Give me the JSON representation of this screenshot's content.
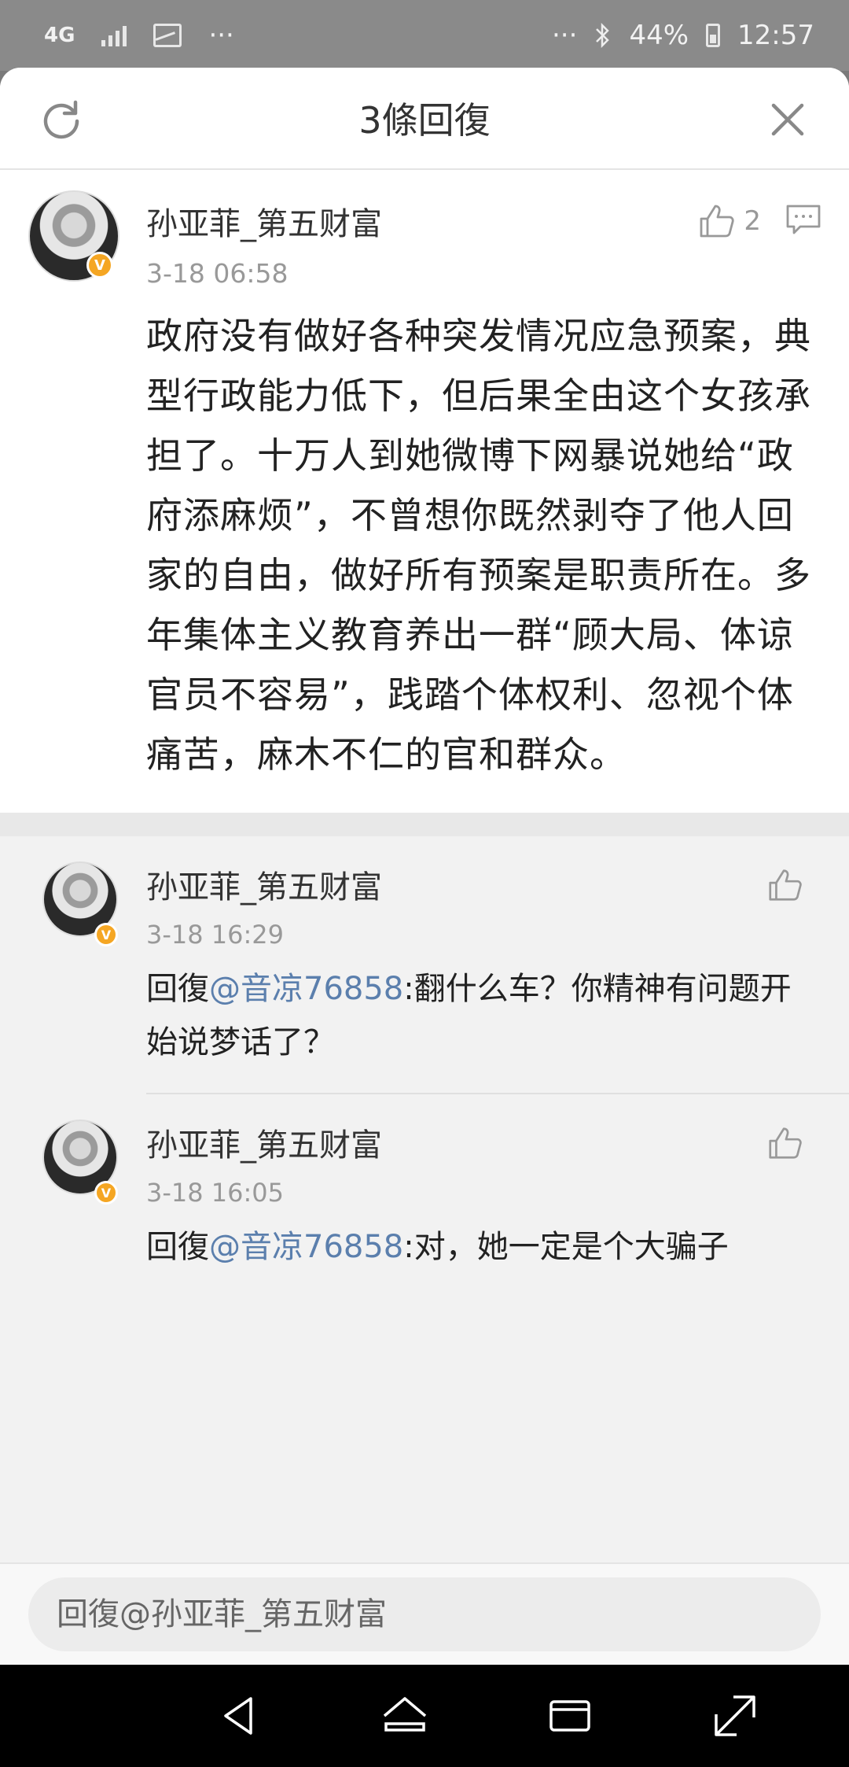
{
  "status_bar": {
    "network": "4G",
    "more": "···",
    "more_right": "···",
    "battery_percent": "44%",
    "time": "12:57"
  },
  "header": {
    "title": "3條回復"
  },
  "main_comment": {
    "username": "孙亚菲_第五财富",
    "time": "3-18 06:58",
    "like_count": "2",
    "text": "政府没有做好各种突发情况应急预案，典型行政能力低下，但后果全由这个女孩承担了。十万人到她微博下网暴说她给“政府添麻烦”，不曾想你既然剥夺了他人回家的自由，做好所有预案是职责所在。多年集体主义教育养出一群“顾大局、体谅官员不容易”，践踏个体权利、忽视个体痛苦，麻木不仁的官和群众。"
  },
  "replies": [
    {
      "username": "孙亚菲_第五财富",
      "time": "3-18 16:29",
      "prefix": "回復",
      "mention": "@音凉76858",
      "text": ":翻什么车？你精神有问题开始说梦话了？"
    },
    {
      "username": "孙亚菲_第五财富",
      "time": "3-18 16:05",
      "prefix": "回復",
      "mention": "@音凉76858",
      "text": ":对，她一定是个大骗子"
    }
  ],
  "input": {
    "placeholder": "回復@孙亚菲_第五财富"
  },
  "badges": {
    "verified": "V"
  },
  "colors": {
    "mention": "#5b7fad",
    "verified_badge": "#f5a623",
    "background": "#f2f2f2"
  },
  "icons": {
    "refresh": "refresh-icon",
    "close": "close-icon",
    "like": "thumbs-up-icon",
    "comment": "comment-icon",
    "nav_back": "back-triangle-icon",
    "nav_home": "home-icon",
    "nav_recents": "recents-icon",
    "nav_expand": "expand-icon"
  }
}
